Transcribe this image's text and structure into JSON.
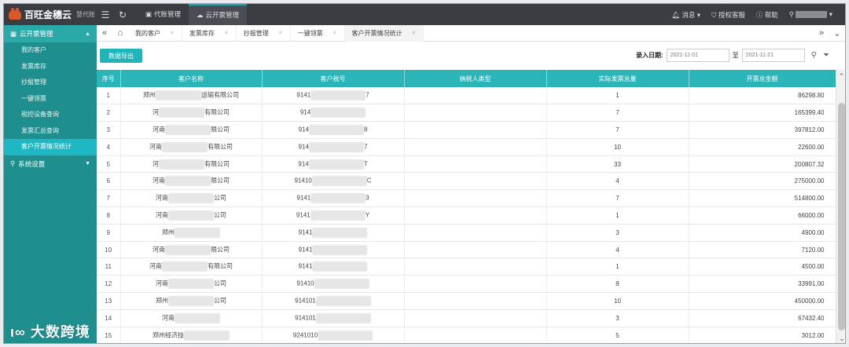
{
  "brand": {
    "name": "百旺金穗云",
    "sub": "慧代账"
  },
  "top_nav": [
    {
      "icon": "briefcase-icon",
      "label": "代账管理"
    },
    {
      "icon": "cloud-icon",
      "label": "云开票管理"
    }
  ],
  "top_right": {
    "messages": "消息",
    "auth": "授权客服",
    "help": "帮助"
  },
  "sidebar": {
    "group1": "云开票管理",
    "items": [
      "我的客户",
      "发票库存",
      "抄报管理",
      "一键领票",
      "税控设备查询",
      "发票汇总查询",
      "客户开票情况统计"
    ],
    "group2": "系统设置"
  },
  "tabs": [
    {
      "label": "我的客户"
    },
    {
      "label": "发票库存"
    },
    {
      "label": "抄报管理"
    },
    {
      "label": "一键领票"
    },
    {
      "label": "客户开票情况统计"
    }
  ],
  "toolbar": {
    "export_label": "数据导出",
    "filter_label": "录入日期:",
    "date_from": "2021-11-01",
    "to_label": "至",
    "date_to": "2021-11-21"
  },
  "table": {
    "headers": [
      "序号",
      "客户名称",
      "客户税号",
      "纳税人类型",
      "实际发票总量",
      "开票总金额"
    ],
    "rows": [
      {
        "seq": "1",
        "name_a": "郑州",
        "name_b": "运输有限公司",
        "tax_a": "9141",
        "tax_b": "7",
        "type": "",
        "count": "1",
        "amount": "86298.80"
      },
      {
        "seq": "2",
        "name_a": "河",
        "name_b": "有限公司",
        "tax_a": "914",
        "tax_b": "",
        "type": "",
        "count": "7",
        "amount": "165399.40"
      },
      {
        "seq": "3",
        "name_a": "河南",
        "name_b": "限公司",
        "tax_a": "914",
        "tax_b": "8",
        "type": "",
        "count": "7",
        "amount": "397812.00"
      },
      {
        "seq": "4",
        "name_a": "河南",
        "name_b": "有限公司",
        "tax_a": "914",
        "tax_b": "7",
        "type": "",
        "count": "10",
        "amount": "22600.00"
      },
      {
        "seq": "5",
        "name_a": "河",
        "name_b": "有限公司",
        "tax_a": "914",
        "tax_b": "T",
        "type": "",
        "count": "33",
        "amount": "200807.32"
      },
      {
        "seq": "6",
        "name_a": "河南",
        "name_b": "限公司",
        "tax_a": "91410",
        "tax_b": "C",
        "type": "",
        "count": "4",
        "amount": "275000.00"
      },
      {
        "seq": "7",
        "name_a": "河南",
        "name_b": "公司",
        "tax_a": "9141",
        "tax_b": "3",
        "type": "",
        "count": "7",
        "amount": "514800.00"
      },
      {
        "seq": "8",
        "name_a": "河南",
        "name_b": "公司",
        "tax_a": "9141",
        "tax_b": "Y",
        "type": "",
        "count": "1",
        "amount": "66000.00"
      },
      {
        "seq": "9",
        "name_a": "郑州",
        "name_b": "",
        "tax_a": "9141",
        "tax_b": "",
        "type": "",
        "count": "3",
        "amount": "4900.00"
      },
      {
        "seq": "10",
        "name_a": "河南",
        "name_b": "限公司",
        "tax_a": "9141",
        "tax_b": "",
        "type": "",
        "count": "4",
        "amount": "7120.00"
      },
      {
        "seq": "11",
        "name_a": "河南",
        "name_b": "有限公司",
        "tax_a": "9141",
        "tax_b": "",
        "type": "",
        "count": "1",
        "amount": "4500.00"
      },
      {
        "seq": "12",
        "name_a": "河南",
        "name_b": "公司",
        "tax_a": "91410",
        "tax_b": "",
        "type": "",
        "count": "8",
        "amount": "33991.00"
      },
      {
        "seq": "13",
        "name_a": "郑州",
        "name_b": "公司",
        "tax_a": "914101",
        "tax_b": "",
        "type": "",
        "count": "10",
        "amount": "450000.00"
      },
      {
        "seq": "14",
        "name_a": "河南",
        "name_b": "",
        "tax_a": "914101",
        "tax_b": "",
        "type": "",
        "count": "3",
        "amount": "67432.40"
      },
      {
        "seq": "15",
        "name_a": "郑州经济技",
        "name_b": "",
        "tax_a": "9241010",
        "tax_b": "",
        "type": "",
        "count": "5",
        "amount": "3012.00"
      }
    ]
  },
  "watermark": "大数跨境"
}
